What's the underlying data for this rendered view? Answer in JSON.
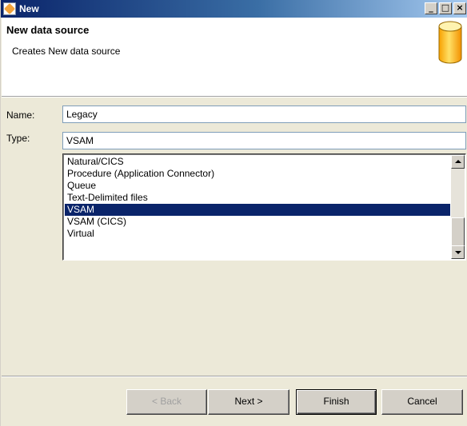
{
  "window": {
    "title": "New"
  },
  "header": {
    "title": "New data source",
    "description": "Creates New data source",
    "icon": "database-icon"
  },
  "form": {
    "name_label": "Name:",
    "name_value": "Legacy",
    "type_label": "Type:",
    "type_value": "VSAM"
  },
  "type_list": {
    "items": [
      "Natural/CICS",
      "Procedure (Application Connector)",
      "Queue",
      "Text-Delimited files",
      "VSAM",
      "VSAM (CICS)",
      "Virtual"
    ],
    "selected": "VSAM"
  },
  "buttons": {
    "back": "< Back",
    "next": "Next >",
    "finish": "Finish",
    "cancel": "Cancel"
  },
  "colors": {
    "selection": "#0a246a",
    "titlebar": "#0a246a",
    "dialog_bg": "#ece9d8"
  }
}
